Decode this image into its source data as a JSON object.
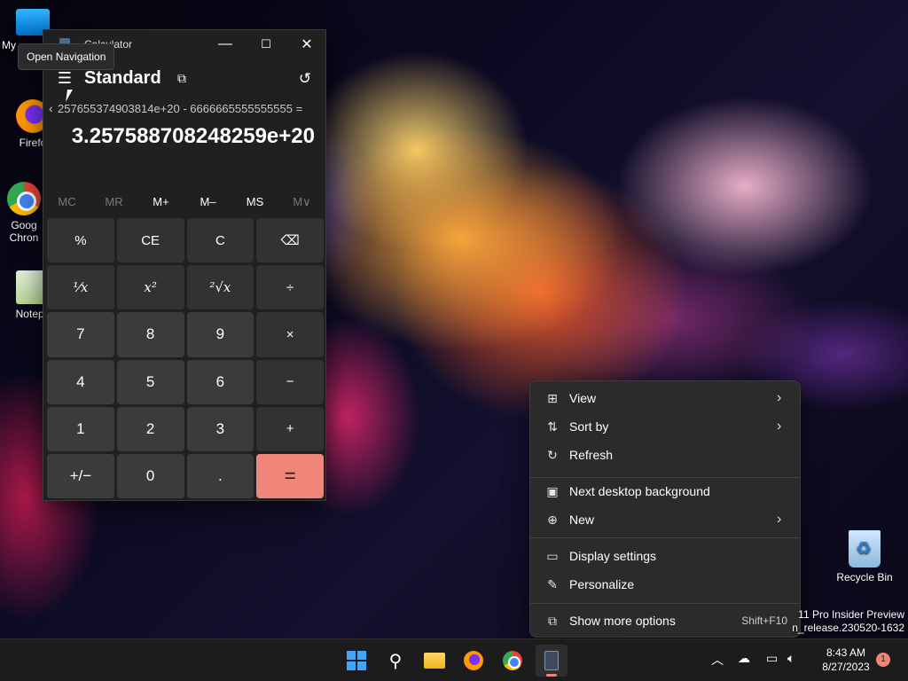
{
  "desktop": {
    "icons": [
      {
        "label": "My",
        "icon": "pc-icon"
      },
      {
        "label": "Firefo",
        "icon": "firefox-icon"
      },
      {
        "label": "Goog Chron",
        "icon": "chrome-icon"
      },
      {
        "label": "Notepa",
        "icon": "notepad-icon"
      },
      {
        "label": "Recycle Bin",
        "icon": "recycle-bin-icon"
      }
    ]
  },
  "calculator": {
    "window_title": "Calculator",
    "tooltip": "Open Navigation",
    "mode": "Standard",
    "expression": "257655374903814e+20 - 6666665555555555 =",
    "display": "3.257588708248259e+20",
    "memory": [
      "MC",
      "MR",
      "M+",
      "M–",
      "MS",
      "M∨"
    ],
    "keys": [
      "%",
      "CE",
      "C",
      "⌫",
      "¹⁄x",
      "x²",
      "²√x",
      "÷",
      "7",
      "8",
      "9",
      "×",
      "4",
      "5",
      "6",
      "−",
      "1",
      "2",
      "3",
      "+",
      "+/−",
      "0",
      ".",
      "="
    ],
    "window_controls": {
      "minimize": "—",
      "maximize": "☐",
      "close": "✕"
    }
  },
  "context_menu": {
    "items": [
      {
        "label": "View",
        "icon": "grid-icon",
        "submenu": true
      },
      {
        "label": "Sort by",
        "icon": "sort-icon",
        "submenu": true
      },
      {
        "label": "Refresh",
        "icon": "refresh-icon",
        "submenu": false
      },
      {
        "label": "Next desktop background",
        "icon": "next-background-icon",
        "submenu": false
      },
      {
        "label": "New",
        "icon": "new-icon",
        "submenu": true
      },
      {
        "label": "Display settings",
        "icon": "display-icon",
        "submenu": false
      },
      {
        "label": "Personalize",
        "icon": "brush-icon",
        "submenu": false
      },
      {
        "label": "Show more options",
        "icon": "more-options-icon",
        "shortcut": "Shift+F10"
      }
    ]
  },
  "watermark": {
    "line1": "11 Pro Insider Preview",
    "line2": "n_release.230520-1632"
  },
  "taskbar": {
    "time": "8:43 AM",
    "date": "8/27/2023",
    "notification_count": "1"
  },
  "colors": {
    "accent": "#f0857a",
    "calc_bg": "#202020",
    "menu_bg": "#2b2b2b"
  }
}
